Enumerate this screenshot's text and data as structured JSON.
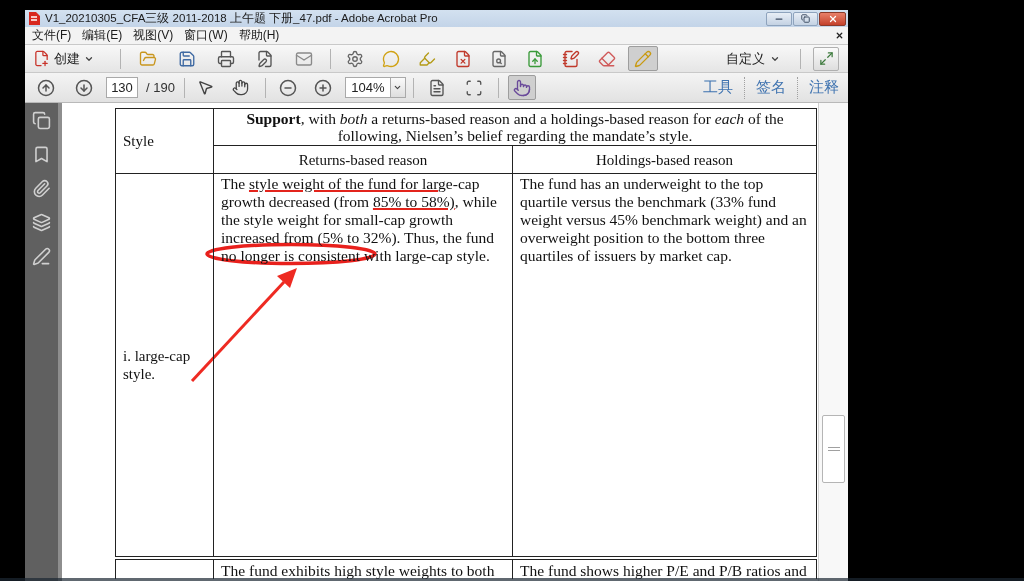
{
  "window": {
    "title": "V1_20210305_CFA三级 2011-2018 上午题 下册_47.pdf - Adobe Acrobat Pro"
  },
  "menu_bar": {
    "items": [
      "文件(F)",
      "编辑(E)",
      "视图(V)",
      "窗口(W)",
      "帮助(H)"
    ]
  },
  "toolbar": {
    "create_label": "创建",
    "tools": [
      {
        "selected": false
      },
      {
        "selected": false
      },
      {
        "selected": false
      },
      {
        "selected": false
      },
      {
        "selected": false
      },
      {
        "selected": false
      },
      {
        "selected": false
      },
      {
        "selected": false
      },
      {
        "selected": false
      },
      {
        "selected": false
      },
      {
        "selected": false
      },
      {
        "selected": false
      },
      {
        "selected": false
      },
      {
        "selected": true
      }
    ],
    "customize_label": "自定义"
  },
  "navigation_bar": {
    "page_number": "130",
    "page_count": "/ 190",
    "zoom": "104%",
    "view_tools": [
      {
        "selected": false
      },
      {
        "selected": false
      },
      {
        "selected": true
      }
    ],
    "panes": [
      "工具",
      "签名",
      "注释"
    ]
  },
  "document": {
    "table": {
      "style_header": "Style",
      "support_header": "**Support**, with *both* a returns-based reason and a holdings-based reason for *each* of the following, Nielsen’s belief regarding the mandate’s style.",
      "subheaders": [
        "Returns-based reason",
        "Holdings-based reason"
      ],
      "rows": [
        {
          "style": "i. large-cap style.",
          "returns_based": "The style weight of the fund for large-cap growth decreased (from 85% to 58%), while the style weight for small-cap growth increased from (5% to 32%). Thus, the fund no longer is consistent with large-cap style.",
          "holdings_based": "The fund has an underweight to the top quartile versus the benchmark (33% fund weight versus 45% benchmark weight) and an overweight position to the bottom three quartiles of issuers by market cap."
        },
        {
          "returns_based": "The fund exhibits high style weights to both",
          "holdings_based": "The fund shows higher P/E and P/B ratios and"
        }
      ]
    }
  }
}
